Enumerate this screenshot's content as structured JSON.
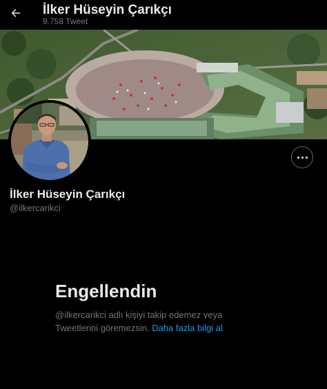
{
  "header": {
    "title": "İlker Hüseyin Çarıkçı",
    "tweet_count": "9.758 Tweet",
    "back_icon": "arrow-left-icon"
  },
  "banner": {
    "description_icon": "aerial-photo-banner"
  },
  "profile": {
    "name": "İlker Hüseyin Çarıkçı",
    "handle": "@ilkercarikci",
    "more_icon": "more-horizontal-icon"
  },
  "blocked": {
    "title": "Engellendin",
    "message": "@ilkercarikci adlı kişiyi takip edemez veya Tweetlerini göremezsin.",
    "link_text": "Daha fazla bilgi al"
  },
  "colors": {
    "background": "#000000",
    "text_primary": "#e7e9ea",
    "text_secondary": "#71767b",
    "link": "#1d9bf0"
  }
}
